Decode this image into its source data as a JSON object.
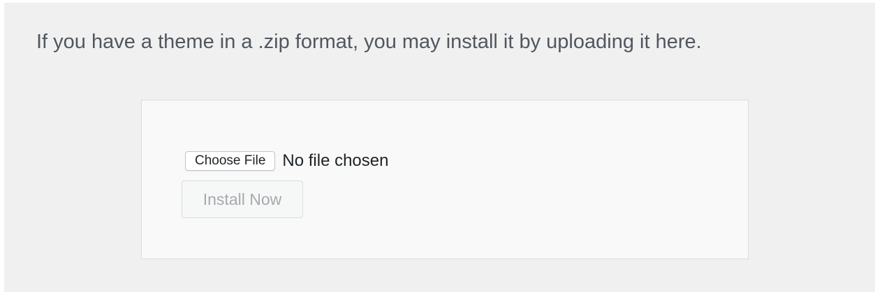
{
  "intro": {
    "text": "If you have a theme in a .zip format, you may install it by uploading it here."
  },
  "upload_form": {
    "choose_file_label": "Choose File",
    "file_status": "No file chosen",
    "install_label": "Install Now",
    "install_disabled": true
  },
  "colors": {
    "page_background": "#f0f0f1",
    "box_background": "#f9f9f9",
    "text": "#50575e",
    "disabled_text": "#a7aaad"
  }
}
